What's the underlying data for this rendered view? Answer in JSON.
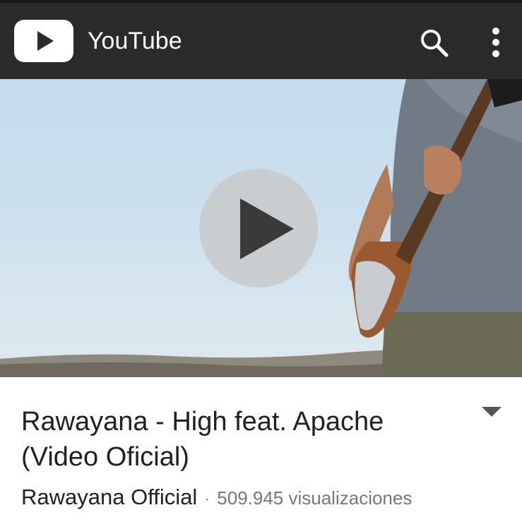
{
  "appbar": {
    "title": "YouTube",
    "logo_icon": "youtube-play-logo-icon",
    "search_icon": "search-icon",
    "menu_icon": "more-vertical-icon",
    "background_color": "#2b2b2b"
  },
  "player": {
    "play_icon": "play-icon"
  },
  "video": {
    "title": "Rawayana - High feat. Apache (Video Oficial)",
    "channel": "Rawayana Official",
    "separator": "·",
    "views": "509.945 visualizaciones",
    "expand_icon": "caret-down-icon"
  }
}
